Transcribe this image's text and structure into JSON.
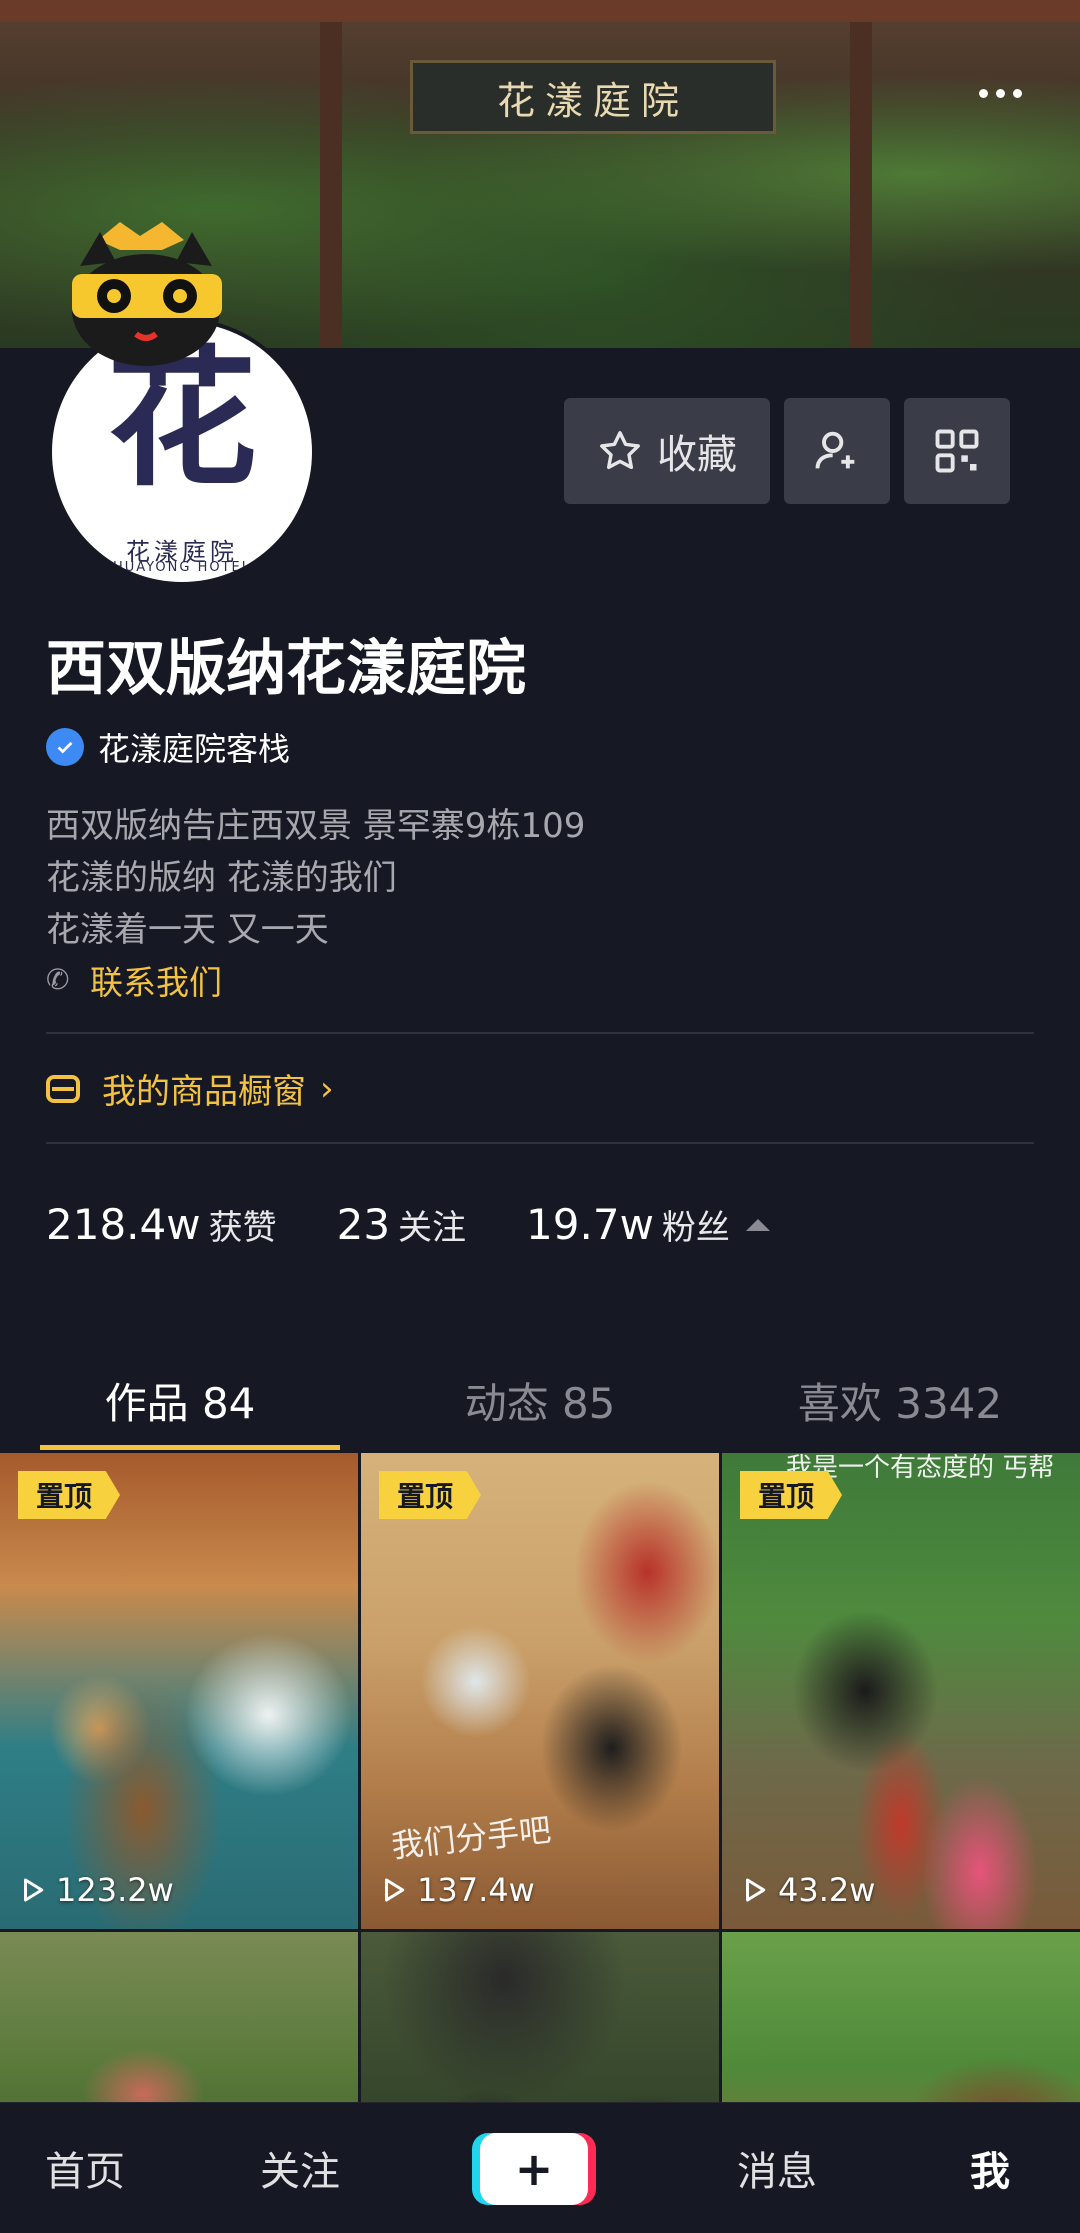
{
  "cover": {
    "sign_text": "花漾庭院"
  },
  "avatar": {
    "char": "花",
    "sub": "花漾庭院",
    "sub_en": "HUAYONG HOTEL"
  },
  "actions": {
    "favorite_label": "收藏"
  },
  "profile": {
    "name": "西双版纳花漾庭院",
    "verified_label": "花漾庭院客栈",
    "bio": [
      "西双版纳告庄西双景 景罕寨9栋109",
      "花漾的版纳 花漾的我们",
      "花漾着一天 又一天"
    ],
    "contact_label": "联系我们",
    "shop_label": "我的商品橱窗",
    "shop_arrow": "›"
  },
  "stats": [
    {
      "num": "218.4w",
      "label": "获赞"
    },
    {
      "num": "23",
      "label": "关注"
    },
    {
      "num": "19.7w",
      "label": "粉丝"
    }
  ],
  "tabs": [
    {
      "label": "作品 84",
      "active": true
    },
    {
      "label": "动态 85",
      "active": false
    },
    {
      "label": "喜欢 3342",
      "active": false
    }
  ],
  "videos": [
    {
      "pinned_label": "置顶",
      "plays": "123.2w",
      "caption": ""
    },
    {
      "pinned_label": "置顶",
      "plays": "137.4w",
      "caption": "我们分手吧"
    },
    {
      "pinned_label": "置顶",
      "plays": "43.2w",
      "caption": "我是一个有态度的 丐帮弟子"
    },
    {
      "pinned_label": "",
      "plays": "",
      "caption": ""
    },
    {
      "pinned_label": "",
      "plays": "",
      "caption": ""
    },
    {
      "pinned_label": "",
      "plays": "",
      "caption": ""
    }
  ],
  "nav": {
    "home": "首页",
    "follow": "关注",
    "create": "+",
    "messages": "消息",
    "me": "我"
  },
  "colors": {
    "background": "#161823",
    "accent": "#f3c243",
    "pin": "#f7d23e",
    "button": "#3a3c47",
    "verified": "#3d8af5"
  }
}
